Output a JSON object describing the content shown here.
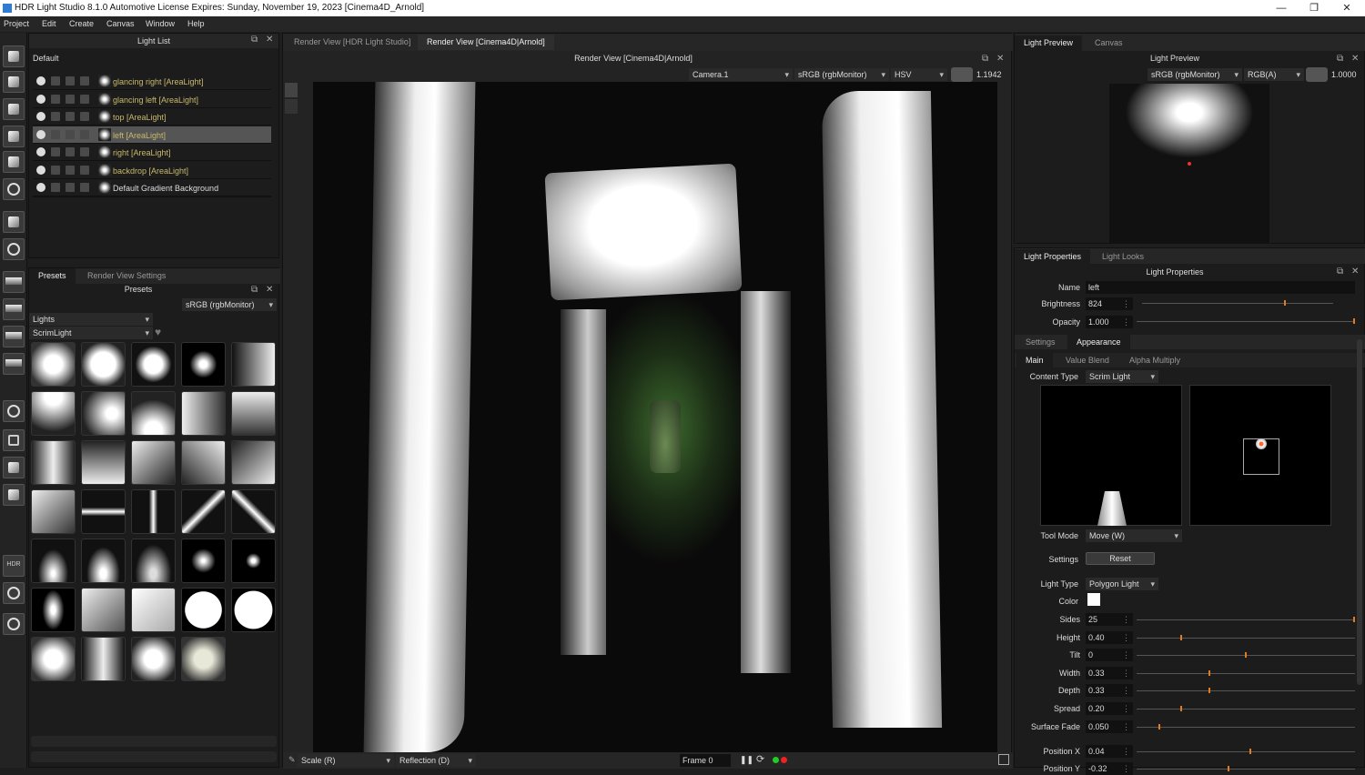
{
  "window": {
    "title": "HDR Light Studio 8.1.0  Automotive License Expires: Sunday, November 19, 2023  [Cinema4D_Arnold]",
    "min": "—",
    "restore": "❐",
    "close": "✕"
  },
  "menu": [
    "Project",
    "Edit",
    "Create",
    "Canvas",
    "Window",
    "Help"
  ],
  "light_list": {
    "title": "Light List",
    "scene": "Default",
    "items": [
      {
        "label": "glancing right [AreaLight]",
        "selected": false
      },
      {
        "label": "glancing left [AreaLight]",
        "selected": false
      },
      {
        "label": "top [AreaLight]",
        "selected": false
      },
      {
        "label": "left [AreaLight]",
        "selected": true
      },
      {
        "label": "right [AreaLight]",
        "selected": false
      },
      {
        "label": "backdrop [AreaLight]",
        "selected": false
      },
      {
        "label": "Default Gradient Background",
        "selected": false
      }
    ]
  },
  "presets": {
    "tabs": [
      "Presets",
      "Render View Settings"
    ],
    "title": "Presets",
    "colorspace": "sRGB (rgbMonitor)",
    "category": "Lights",
    "subcategory": "ScrimLight"
  },
  "render_view": {
    "tabs": [
      "Render View [HDR Light Studio]",
      "Render View [Cinema4D|Arnold]"
    ],
    "title": "Render View [Cinema4D|Arnold]",
    "camera": "Camera.1",
    "colorspace": "sRGB (rgbMonitor)",
    "mode": "HSV",
    "exposure": "1.1942",
    "scale": "Scale (R)",
    "reflection": "Reflection (D)",
    "frame": "Frame 0"
  },
  "light_preview": {
    "tabs": [
      "Light Preview",
      "Canvas"
    ],
    "title": "Light Preview",
    "colorspace": "sRGB (rgbMonitor)",
    "channel": "RGB(A)",
    "exposure": "1.0000"
  },
  "props": {
    "tabs": [
      "Light Properties",
      "Light Looks"
    ],
    "title": "Light Properties",
    "name_label": "Name",
    "name": "left",
    "brightness_label": "Brightness",
    "brightness": "824",
    "opacity_label": "Opacity",
    "opacity": "1.000",
    "subtabs": [
      "Settings",
      "Appearance"
    ],
    "subsubtabs": [
      "Main",
      "Value Blend",
      "Alpha Multiply"
    ],
    "content_type_label": "Content Type",
    "content_type": "Scrim Light",
    "tool_mode_label": "Tool Mode",
    "tool_mode": "Move (W)",
    "settings_label": "Settings",
    "reset": "Reset",
    "light_type_label": "Light Type",
    "light_type": "Polygon Light",
    "color_label": "Color",
    "params": [
      {
        "label": "Sides",
        "value": "25",
        "level": 1.0
      },
      {
        "label": "Height",
        "value": "0.40",
        "level": 0.2
      },
      {
        "label": "Tilt",
        "value": "0",
        "level": 0.5
      },
      {
        "label": "Width",
        "value": "0.33",
        "level": 0.33
      },
      {
        "label": "Depth",
        "value": "0.33",
        "level": 0.33
      },
      {
        "label": "Spread",
        "value": "0.20",
        "level": 0.2
      },
      {
        "label": "Surface Fade",
        "value": "0.050",
        "level": 0.1
      }
    ],
    "pos": [
      {
        "label": "Position X",
        "value": "0.04",
        "level": 0.52
      },
      {
        "label": "Position Y",
        "value": "-0.32",
        "level": 0.42
      }
    ]
  },
  "colors": {
    "accent": "#e07b20",
    "light_label": "#c9b96a"
  }
}
